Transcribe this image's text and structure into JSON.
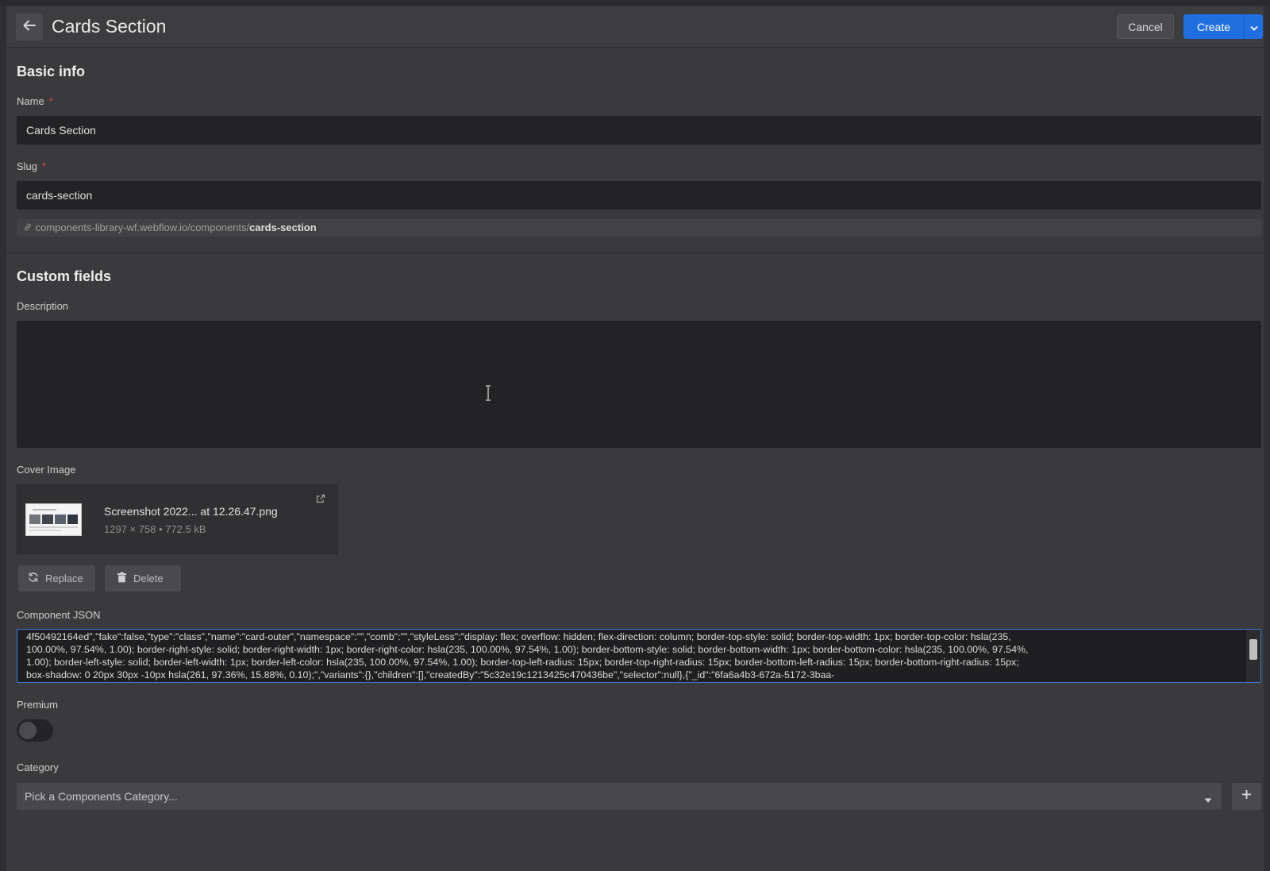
{
  "header": {
    "title": "Cards Section",
    "cancel_label": "Cancel",
    "create_label": "Create"
  },
  "basic_info": {
    "heading": "Basic info",
    "name_label": "Name",
    "name_value": "Cards Section",
    "slug_label": "Slug",
    "slug_value": "cards-section",
    "url_prefix": "components-library-wf.webflow.io/components/",
    "url_slug": "cards-section"
  },
  "custom_fields": {
    "heading": "Custom fields",
    "description_label": "Description",
    "description_value": "",
    "cover_image_label": "Cover Image",
    "cover_file_name": "Screenshot 2022... at 12.26.47.png",
    "cover_file_meta": "1297 × 758 • 772.5 kB",
    "replace_label": "Replace",
    "delete_label": "Delete",
    "component_json_label": "Component JSON",
    "component_json_lines": [
      "4f50492164ed\",\"fake\":false,\"type\":\"class\",\"name\":\"card-outer\",\"namespace\":\"\",\"comb\":\"\",\"styleLess\":\"display: flex; overflow: hidden; flex-direction: column; border-top-style: solid; border-top-width: 1px; border-top-color: hsla(235,",
      "100.00%, 97.54%, 1.00); border-right-style: solid; border-right-width: 1px; border-right-color: hsla(235, 100.00%, 97.54%, 1.00); border-bottom-style: solid; border-bottom-width: 1px; border-bottom-color: hsla(235, 100.00%, 97.54%,",
      "1.00); border-left-style: solid; border-left-width: 1px; border-left-color: hsla(235, 100.00%, 97.54%, 1.00); border-top-left-radius: 15px; border-top-right-radius: 15px; border-bottom-left-radius: 15px; border-bottom-right-radius: 15px;",
      "box-shadow: 0 20px 30px -10px hsla(261, 97.36%, 15.88%, 0.10);\",\"variants\":{},\"children\":[],\"createdBy\":\"5c32e19c1213425c470436be\",\"selector\":null},{\"_id\":\"6fa6a4b3-672a-5172-3baa-"
    ],
    "premium_label": "Premium",
    "premium_on": false,
    "category_label": "Category",
    "category_placeholder": "Pick a Components Category..."
  },
  "colors": {
    "accent": "#1f6fe0",
    "required": "#e5484d",
    "background": "#3a3a3d",
    "input": "#232325"
  },
  "icons": {
    "back": "arrow-left-icon",
    "link": "link-icon",
    "external": "external-link-icon",
    "replace": "refresh-icon",
    "delete": "trash-icon",
    "dropdown": "chevron-down-icon",
    "add": "plus-icon"
  }
}
